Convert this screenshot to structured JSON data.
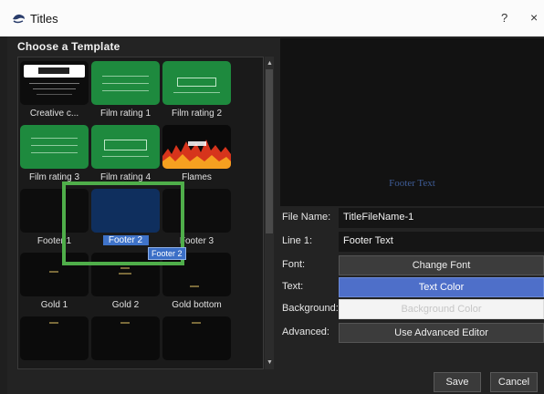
{
  "window": {
    "title": "Titles",
    "help": "?",
    "close": "×"
  },
  "chooser": {
    "heading": "Choose a Template",
    "templates": [
      {
        "label": "Creative c...",
        "style": "creative"
      },
      {
        "label": "Film rating 1",
        "style": "green"
      },
      {
        "label": "Film rating 2",
        "style": "green"
      },
      {
        "label": "Film rating 3",
        "style": "green"
      },
      {
        "label": "Film rating 4",
        "style": "green"
      },
      {
        "label": "Flames",
        "style": "flames"
      },
      {
        "label": "Footer 1",
        "style": "black"
      },
      {
        "label": "Footer 2",
        "style": "blue",
        "selected": true
      },
      {
        "label": "Footer 3",
        "style": "black"
      },
      {
        "label": "Gold 1",
        "style": "gold"
      },
      {
        "label": "Gold 2",
        "style": "gold"
      },
      {
        "label": "Gold bottom",
        "style": "gold"
      },
      {
        "label": "",
        "style": "gold"
      },
      {
        "label": "",
        "style": "gold"
      },
      {
        "label": "",
        "style": "gold"
      }
    ],
    "tooltip": "Footer 2"
  },
  "preview": {
    "text": "Footer Text"
  },
  "form": {
    "file_name_label": "File Name:",
    "file_name_value": "TitleFileName-1",
    "line1_label": "Line 1:",
    "line1_value": "Footer Text",
    "font_label": "Font:",
    "font_button": "Change Font",
    "text_label": "Text:",
    "text_button": "Text Color",
    "background_label": "Background:",
    "background_button": "Background Color",
    "advanced_label": "Advanced:",
    "advanced_button": "Use Advanced Editor"
  },
  "buttons": {
    "save": "Save",
    "cancel": "Cancel"
  },
  "colors": {
    "accent_blue": "#4e6fc9",
    "highlight_green": "#4fae4a",
    "thumb_green": "#1e8a3e"
  }
}
